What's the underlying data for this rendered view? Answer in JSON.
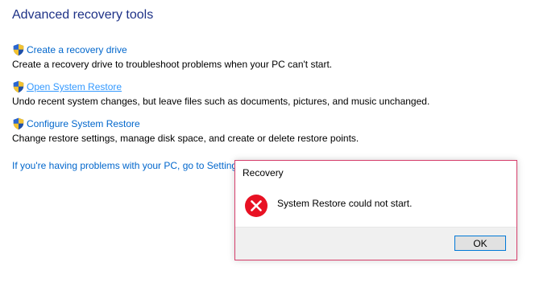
{
  "page": {
    "title": "Advanced recovery tools"
  },
  "tools": [
    {
      "link": "Create a recovery drive",
      "description": "Create a recovery drive to troubleshoot problems when your PC can't start.",
      "icon": "uac-shield-icon"
    },
    {
      "link": "Open System Restore",
      "description": "Undo recent system changes, but leave files such as documents, pictures, and music unchanged.",
      "icon": "uac-shield-icon"
    },
    {
      "link": "Configure System Restore",
      "description": "Change restore settings, manage disk space, and create or delete restore points.",
      "icon": "uac-shield-icon"
    }
  ],
  "settings_link": "If you're having problems with your PC, go to Settings",
  "dialog": {
    "title": "Recovery",
    "message": "System Restore could not start.",
    "ok_label": "OK",
    "icon": "error-icon"
  },
  "colors": {
    "title": "#1e3287",
    "link": "#0066cc",
    "link_hover": "#3399ff",
    "dialog_border": "#d63e6b",
    "error_red": "#e81123",
    "button_focus": "#0078d7"
  }
}
